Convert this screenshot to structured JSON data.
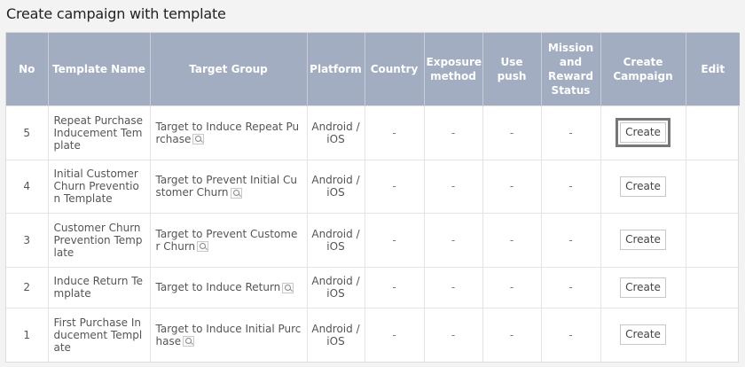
{
  "page": {
    "title": "Create campaign with template"
  },
  "columns": [
    "No",
    "Template Name",
    "Target Group",
    "Platform",
    "Country",
    "Exposure method",
    "Use push",
    "Mission and Reward Status",
    "Create Campaign",
    "Edit"
  ],
  "rows": [
    {
      "no": "5",
      "template": "Repeat Purchase Inducement Template",
      "target": "Target to Induce Repeat Purchase",
      "platform": "Android / iOS",
      "country": "-",
      "exposure": "-",
      "push": "-",
      "mission": "-",
      "create": "Create",
      "edit": ""
    },
    {
      "no": "4",
      "template": "Initial Customer Churn Prevention Template",
      "target": "Target to Prevent Initial Customer Churn",
      "platform": "Android / iOS",
      "country": "-",
      "exposure": "-",
      "push": "-",
      "mission": "-",
      "create": "Create",
      "edit": ""
    },
    {
      "no": "3",
      "template": "Customer Churn Prevention Template",
      "target": "Target to Prevent Customer Churn",
      "platform": "Android / iOS",
      "country": "-",
      "exposure": "-",
      "push": "-",
      "mission": "-",
      "create": "Create",
      "edit": ""
    },
    {
      "no": "2",
      "template": "Induce Return Template",
      "target": "Target to Induce Return",
      "platform": "Android / iOS",
      "country": "-",
      "exposure": "-",
      "push": "-",
      "mission": "-",
      "create": "Create",
      "edit": ""
    },
    {
      "no": "1",
      "template": "First Purchase Inducement Template",
      "target": "Target to Induce Initial Purchase",
      "platform": "Android / iOS",
      "country": "-",
      "exposure": "-",
      "push": "-",
      "mission": "-",
      "create": "Create",
      "edit": ""
    }
  ],
  "icons": {
    "target_search": "magnifier-icon"
  },
  "colors": {
    "header_bg": "#a2adc2",
    "page_bg": "#f3f3f3",
    "focus_outline": "#777777"
  }
}
